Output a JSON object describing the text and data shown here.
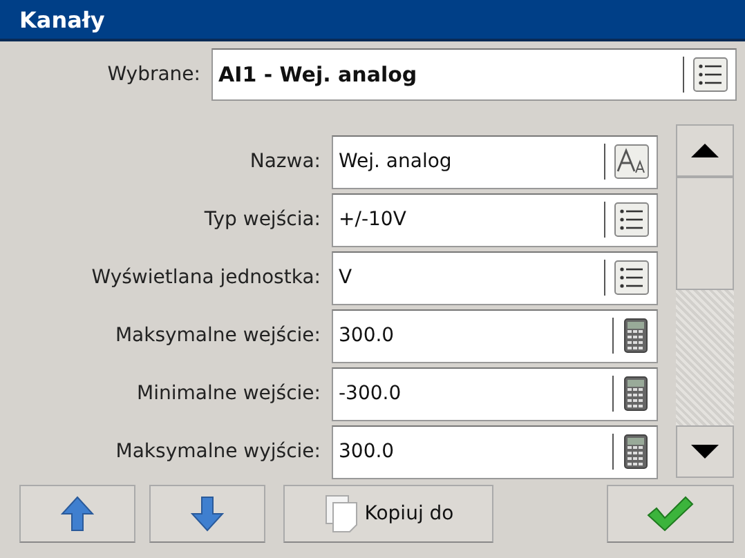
{
  "window": {
    "title": "Kanały"
  },
  "selected": {
    "label": "Wybrane:",
    "value": "AI1 - Wej. analog"
  },
  "fields": [
    {
      "label": "Nazwa:",
      "value": "Wej. analog",
      "kind": "text"
    },
    {
      "label": "Typ wejścia:",
      "value": "+/-10V",
      "kind": "list"
    },
    {
      "label": "Wyświetlana jednostka:",
      "value": "V",
      "kind": "list"
    },
    {
      "label": "Maksymalne wejście:",
      "value": "300.0",
      "kind": "number"
    },
    {
      "label": "Minimalne wejście:",
      "value": "-300.0",
      "kind": "number"
    },
    {
      "label": "Maksymalne wyjście:",
      "value": "300.0",
      "kind": "number"
    }
  ],
  "buttons": {
    "copy": "Kopiuj do"
  }
}
